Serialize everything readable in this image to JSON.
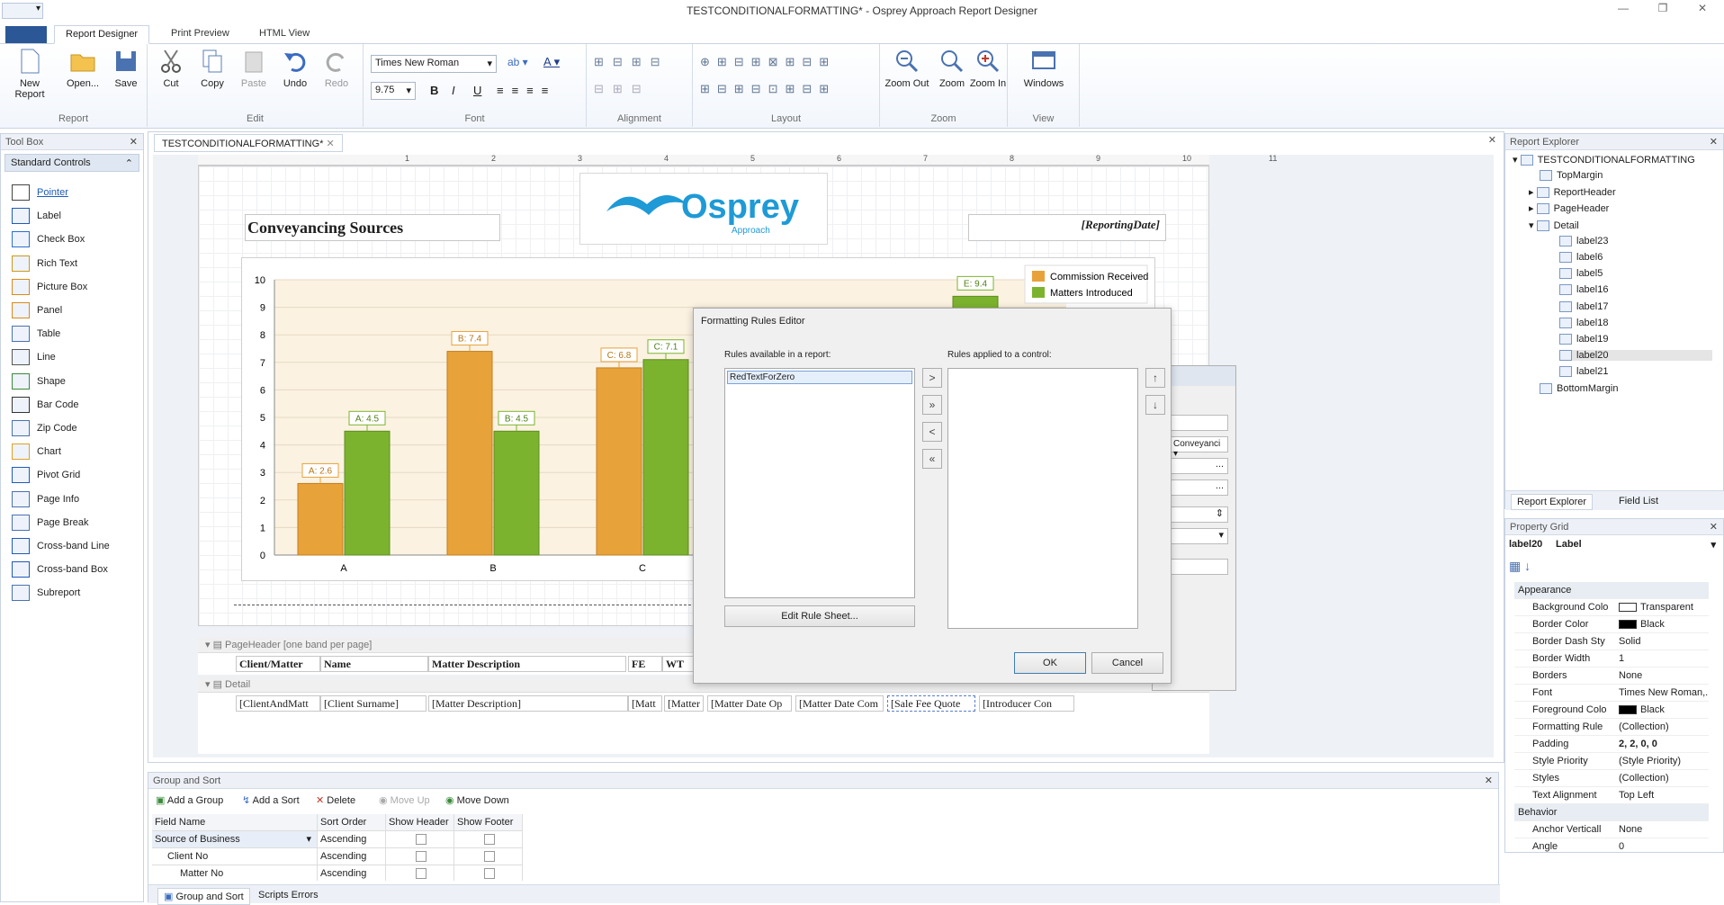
{
  "window": {
    "title": "TESTCONDITIONALFORMATTING* - Osprey Approach Report Designer"
  },
  "tabs": [
    "Report Designer",
    "Print Preview",
    "HTML View"
  ],
  "ribbon": {
    "report": {
      "label": "Report",
      "new": "New Report",
      "open": "Open...",
      "save": "Save"
    },
    "edit": {
      "label": "Edit",
      "cut": "Cut",
      "copy": "Copy",
      "paste": "Paste",
      "undo": "Undo",
      "redo": "Redo"
    },
    "font": {
      "label": "Font",
      "family": "Times New Roman",
      "size": "9.75"
    },
    "alignment": {
      "label": "Alignment"
    },
    "layout": {
      "label": "Layout"
    },
    "zoom": {
      "label": "Zoom",
      "out": "Zoom Out",
      "zoom": "Zoom",
      "in": "Zoom In"
    },
    "view": {
      "label": "View",
      "windows": "Windows"
    }
  },
  "toolbox": {
    "title": "Tool Box",
    "section": "Standard Controls",
    "items": [
      "Pointer",
      "Label",
      "Check Box",
      "Rich Text",
      "Picture Box",
      "Panel",
      "Table",
      "Line",
      "Shape",
      "Bar Code",
      "Zip Code",
      "Chart",
      "Pivot Grid",
      "Page Info",
      "Page Break",
      "Cross-band Line",
      "Cross-band Box",
      "Subreport"
    ]
  },
  "doc": {
    "tab": "TESTCONDITIONALFORMATTING*"
  },
  "ruler": [
    "1",
    "2",
    "3",
    "4",
    "5",
    "6",
    "7",
    "8",
    "9",
    "10",
    "11"
  ],
  "report": {
    "title": "Conveyancing Sources",
    "logo": "Osprey",
    "logo_sub": "Approach",
    "date": "[ReportingDate]"
  },
  "chart_data": {
    "type": "bar",
    "categories": [
      "A",
      "B",
      "C"
    ],
    "series": [
      {
        "name": "Commission Received",
        "values": [
          2.6,
          7.4,
          6.8
        ]
      },
      {
        "name": "Matters Introduced",
        "values": [
          4.5,
          4.5,
          7.1
        ]
      }
    ],
    "extra_label": "E: 9.4",
    "ylim": [
      0,
      10
    ],
    "yticks": [
      "0",
      "1",
      "2",
      "3",
      "4",
      "5",
      "6",
      "7",
      "8",
      "9",
      "10"
    ],
    "data_labels": [
      [
        "A: 2.6",
        "B: 7.4",
        "C: 6.8"
      ],
      [
        "A: 4.5",
        "B: 4.5",
        "C: 7.1"
      ]
    ],
    "legend": "top-right",
    "colors": [
      "#e8a23a",
      "#7cb32e"
    ]
  },
  "bands": {
    "pageheader": "PageHeader [one band per page]",
    "detail": "Detail",
    "headers": [
      "Client/Matter",
      "Name",
      "Matter Description",
      "FE",
      "WT"
    ],
    "fields": [
      "[ClientAndMatt",
      "[Client Surname]",
      "[Matter Description]",
      "[Matt",
      "[Matter W",
      "[Matter Date Op",
      "[Matter Date Com",
      "[Sale Fee Quote",
      "[Introducer Con"
    ]
  },
  "dialog": {
    "title": "Formatting Rules Editor",
    "available_label": "Rules available in a report:",
    "applied_label": "Rules applied to a control:",
    "rules": [
      "RedTextForZero"
    ],
    "edit_rule_sheet": "Edit Rule Sheet...",
    "ok": "OK",
    "cancel": "Cancel",
    "arrows": [
      ">",
      "»",
      "<",
      "«"
    ],
    "updown": [
      "↑",
      "↓"
    ]
  },
  "behind_dialog": {
    "combo_value": "Conveyanci",
    "ellipsis": "..."
  },
  "explorer": {
    "title": "Report Explorer",
    "root": "TESTCONDITIONALFORMATTING",
    "items": [
      "TopMargin",
      "ReportHeader",
      "PageHeader",
      "Detail",
      "label23",
      "label6",
      "label5",
      "label16",
      "label17",
      "label18",
      "label19",
      "label20",
      "label21",
      "BottomMargin"
    ],
    "tabs": [
      "Report Explorer",
      "Field List"
    ]
  },
  "propgrid": {
    "title": "Property Grid",
    "object": "label20",
    "object_type": "Label",
    "rows": [
      {
        "cat": "Appearance"
      },
      {
        "n": "Background Colo",
        "v": "Transparent",
        "swatch": "#ffffff"
      },
      {
        "n": "Border Color",
        "v": "Black",
        "swatch": "#000000"
      },
      {
        "n": "Border Dash Sty",
        "v": "Solid"
      },
      {
        "n": "Border Width",
        "v": "1"
      },
      {
        "n": "Borders",
        "v": "None"
      },
      {
        "n": "Font",
        "v": "Times New Roman,..."
      },
      {
        "n": "Foreground Colo",
        "v": "Black",
        "swatch": "#000000"
      },
      {
        "n": "Formatting Rule",
        "v": "(Collection)"
      },
      {
        "n": "Padding",
        "v": "2, 2, 0, 0"
      },
      {
        "n": "Style Priority",
        "v": "(Style Priority)"
      },
      {
        "n": "Styles",
        "v": "(Collection)"
      },
      {
        "n": "Text Alignment",
        "v": "Top Left"
      },
      {
        "cat": "Behavior"
      },
      {
        "n": "Anchor Verticall",
        "v": "None"
      },
      {
        "n": "Angle",
        "v": "0"
      }
    ]
  },
  "groupsort": {
    "title": "Group and Sort",
    "toolbar": [
      "Add a Group",
      "Add a Sort",
      "Delete",
      "Move Up",
      "Move Down"
    ],
    "columns": [
      "Field Name",
      "Sort Order",
      "Show Header",
      "Show Footer"
    ],
    "rows": [
      {
        "field": "Source of Business",
        "order": "Ascending"
      },
      {
        "field": "Client No",
        "order": "Ascending"
      },
      {
        "field": "Matter No",
        "order": "Ascending"
      }
    ],
    "tabs": [
      "Group and Sort",
      "Scripts Errors"
    ]
  }
}
